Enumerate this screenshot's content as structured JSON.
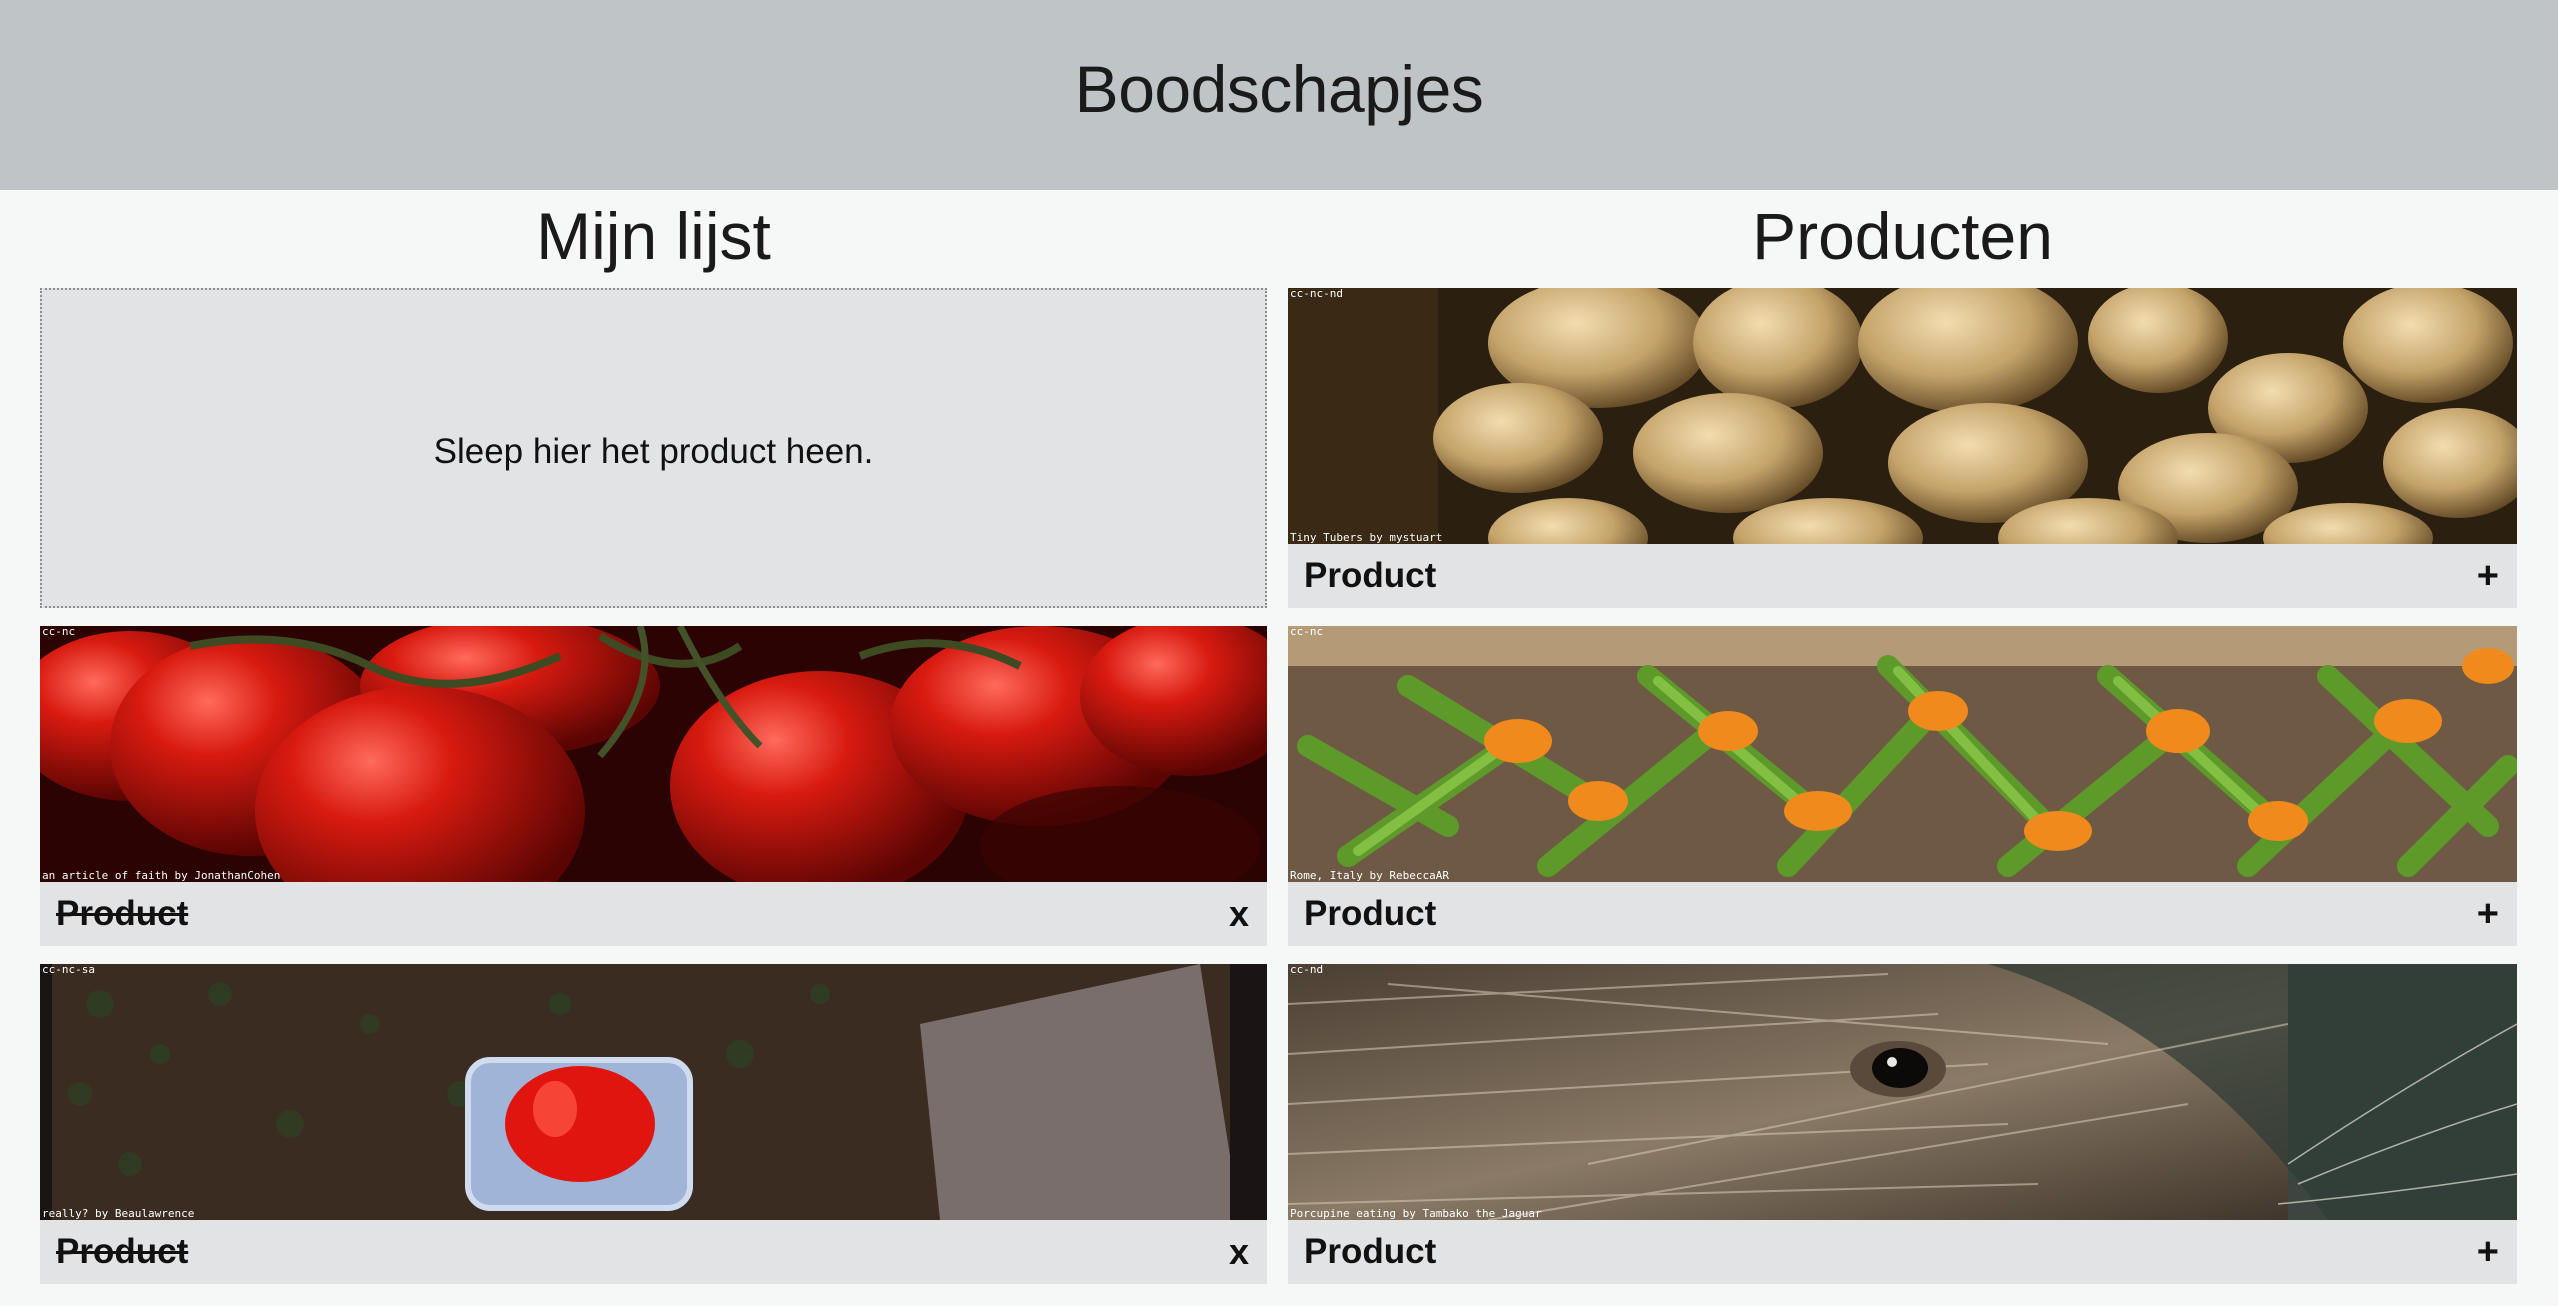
{
  "header": {
    "title": "Boodschapjes"
  },
  "columns": {
    "list_title": "Mijn lijst",
    "products_title": "Producten"
  },
  "dropzone": {
    "text": "Sleep hier het product heen."
  },
  "my_list": [
    {
      "label": "Product",
      "remove_label": "x",
      "license": "cc-nc",
      "credit": "an article of faith by JonathanCohen",
      "image": "tomatoes"
    },
    {
      "label": "Product",
      "remove_label": "x",
      "license": "cc-nc-sa",
      "credit": "really? by Beaulawrence",
      "image": "red-pepper"
    }
  ],
  "products": [
    {
      "label": "Product",
      "add_label": "+",
      "license": "cc-nc-nd",
      "credit": "Tiny Tubers by mystuart",
      "image": "potatoes"
    },
    {
      "label": "Product",
      "add_label": "+",
      "license": "cc-nc",
      "credit": "Rome, Italy by RebeccaAR",
      "image": "zucchini-flowers"
    },
    {
      "label": "Product",
      "add_label": "+",
      "license": "cc-nd",
      "credit": "Porcupine eating by Tambako the Jaguar",
      "image": "porcupine"
    }
  ]
}
